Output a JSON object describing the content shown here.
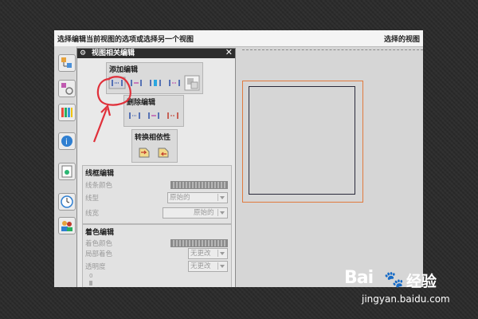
{
  "status_bar": {
    "left_text": "选择编辑当前视图的选项或选择另一个视图",
    "right_text": "选择的视图"
  },
  "dialog": {
    "title": "视图相关编辑",
    "gear_glyph": "⚙",
    "close_glyph": "✕",
    "add_edit_label": "添加编辑",
    "delete_edit_label": "删除编辑",
    "convert_label": "转换相依性",
    "wireframe": {
      "title": "线框编辑",
      "line_color_label": "线条颜色",
      "line_type_label": "线型",
      "line_type_value": "原始的",
      "line_width_label": "线宽",
      "line_width_value": "原始的"
    },
    "shading": {
      "title": "着色编辑",
      "shade_color_label": "着色颜色",
      "local_shade_label": "局部着色",
      "local_shade_value": "无更改",
      "transparency_label": "透明度",
      "transparency_value": "无更改",
      "slider_zero": "0"
    }
  },
  "annotation_color": "#e0303a",
  "viewport": {
    "frame_color": "#e07a3e"
  },
  "watermark": {
    "brand": "Bai",
    "paw": "🐾",
    "suffix": "经验",
    "url": "jingyan.baidu.com"
  }
}
